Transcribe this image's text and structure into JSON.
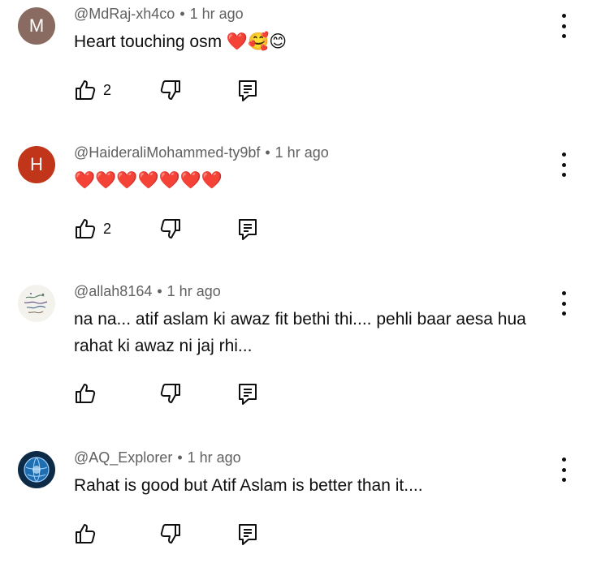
{
  "comments": [
    {
      "avatar_letter": "M",
      "author": "@MdRaj-xh4co",
      "time": "1 hr ago",
      "text": "Heart touching osm ❤️🥰😊",
      "likes": "2"
    },
    {
      "avatar_letter": "H",
      "author": "@HaideraliMohammed-ty9bf",
      "time": "1 hr ago",
      "text": "❤️❤️❤️❤️❤️❤️❤️",
      "likes": "2"
    },
    {
      "avatar_letter": "",
      "author": "@allah8164",
      "time": "1 hr ago",
      "text": "na na... atif aslam ki awaz fit bethi thi.... pehli baar  aesa hua rahat ki awaz ni jaj rhi...",
      "likes": ""
    },
    {
      "avatar_letter": "",
      "author": "@AQ_Explorer",
      "time": "1 hr ago",
      "text": "Rahat is good but Atif Aslam is better than it....",
      "likes": ""
    }
  ],
  "separator": "•",
  "icons": {
    "like": "thumbs-up-icon",
    "dislike": "thumbs-down-icon",
    "reply": "reply-comment-icon",
    "menu": "more-vertical-icon"
  }
}
